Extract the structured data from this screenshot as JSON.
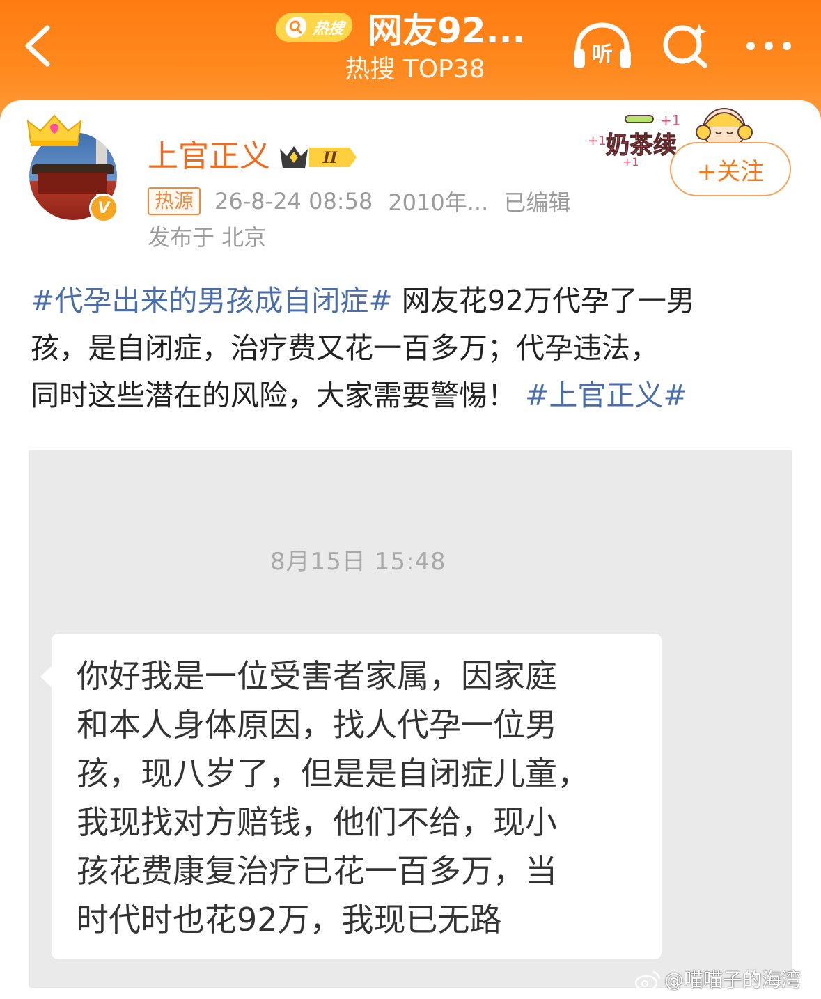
{
  "header": {
    "hot_pill_label": "热搜",
    "title": "网友92...",
    "subtitle": "热搜 TOP38",
    "listen_label": "听"
  },
  "post": {
    "username": "上官正义",
    "vip_level": "II",
    "hot_tag": "热源",
    "time": "26-8-24 08:58",
    "extra": "2010年...",
    "edited": "已编辑",
    "location": "发布于 北京",
    "follow_label": "+关注",
    "verified_mark": "V",
    "sticker_text": "奶茶续",
    "sticker_plus": "+1",
    "text": {
      "line1_tag": "#代孕出来的男孩成自闭症#",
      "line1_rest": " 网友花92万代孕了一男",
      "line2": "孩，是自闭症，治疗费又花一百多万；代孕违法，",
      "line3_rest": "同时这些潜在的风险，大家需要警惕！ ",
      "line3_tag": "#上官正义#"
    }
  },
  "image": {
    "msg_time": "8月15日 15:48",
    "message_lines": [
      "你好我是一位受害者家属，因家庭",
      "和本人身体原因，找人代孕一位男",
      "孩，现八岁了，但是是自闭症儿童，",
      "我现找对方赔钱，他们不给，现小",
      "孩花费康复治疗已花一百多万，当",
      "时代时也花92万，我现已无路"
    ],
    "watermark": "@喵喵子的海湾"
  },
  "colors": {
    "header_orange": "#ff8a1f",
    "username_orange": "#f26b1d",
    "hashtag_blue": "#4b6ea8",
    "meta_gray": "#9c9c9c"
  }
}
